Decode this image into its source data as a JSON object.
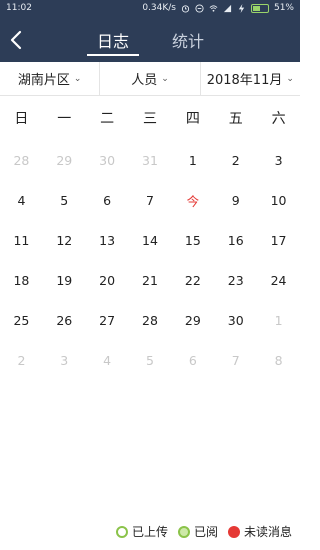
{
  "status_bar": {
    "time": "11:02",
    "network_speed": "0.34K/s",
    "battery": "51%",
    "battery_level": 0.51
  },
  "nav": {
    "back_icon": "chevron-left-icon",
    "tabs": [
      {
        "label": "日志",
        "active": true
      },
      {
        "label": "统计",
        "active": false
      }
    ]
  },
  "filters": {
    "region": "湖南片区",
    "person": "人员",
    "month": "2018年11月"
  },
  "calendar": {
    "weekdays": [
      "日",
      "一",
      "二",
      "三",
      "四",
      "五",
      "六"
    ],
    "days": [
      {
        "d": "28",
        "muted": true
      },
      {
        "d": "29",
        "muted": true
      },
      {
        "d": "30",
        "muted": true
      },
      {
        "d": "31",
        "muted": true
      },
      {
        "d": "1"
      },
      {
        "d": "2"
      },
      {
        "d": "3"
      },
      {
        "d": "4"
      },
      {
        "d": "5"
      },
      {
        "d": "6"
      },
      {
        "d": "7"
      },
      {
        "d": "今",
        "today": true
      },
      {
        "d": "9"
      },
      {
        "d": "10"
      },
      {
        "d": "11"
      },
      {
        "d": "12"
      },
      {
        "d": "13"
      },
      {
        "d": "14"
      },
      {
        "d": "15"
      },
      {
        "d": "16"
      },
      {
        "d": "17"
      },
      {
        "d": "18"
      },
      {
        "d": "19"
      },
      {
        "d": "20"
      },
      {
        "d": "21"
      },
      {
        "d": "22"
      },
      {
        "d": "23"
      },
      {
        "d": "24"
      },
      {
        "d": "25"
      },
      {
        "d": "26"
      },
      {
        "d": "27"
      },
      {
        "d": "28"
      },
      {
        "d": "29"
      },
      {
        "d": "30"
      },
      {
        "d": "1",
        "muted": true
      },
      {
        "d": "2",
        "muted": true
      },
      {
        "d": "3",
        "muted": true
      },
      {
        "d": "4",
        "muted": true
      },
      {
        "d": "5",
        "muted": true
      },
      {
        "d": "6",
        "muted": true
      },
      {
        "d": "7",
        "muted": true
      },
      {
        "d": "8",
        "muted": true
      }
    ]
  },
  "legend": {
    "uploaded": "已上传",
    "read": "已阅",
    "unread": "未读消息"
  },
  "colors": {
    "header_bg": "#2d3d57",
    "today": "#e53935",
    "legend_green": "#8bc34a",
    "unread": "#e53935"
  }
}
